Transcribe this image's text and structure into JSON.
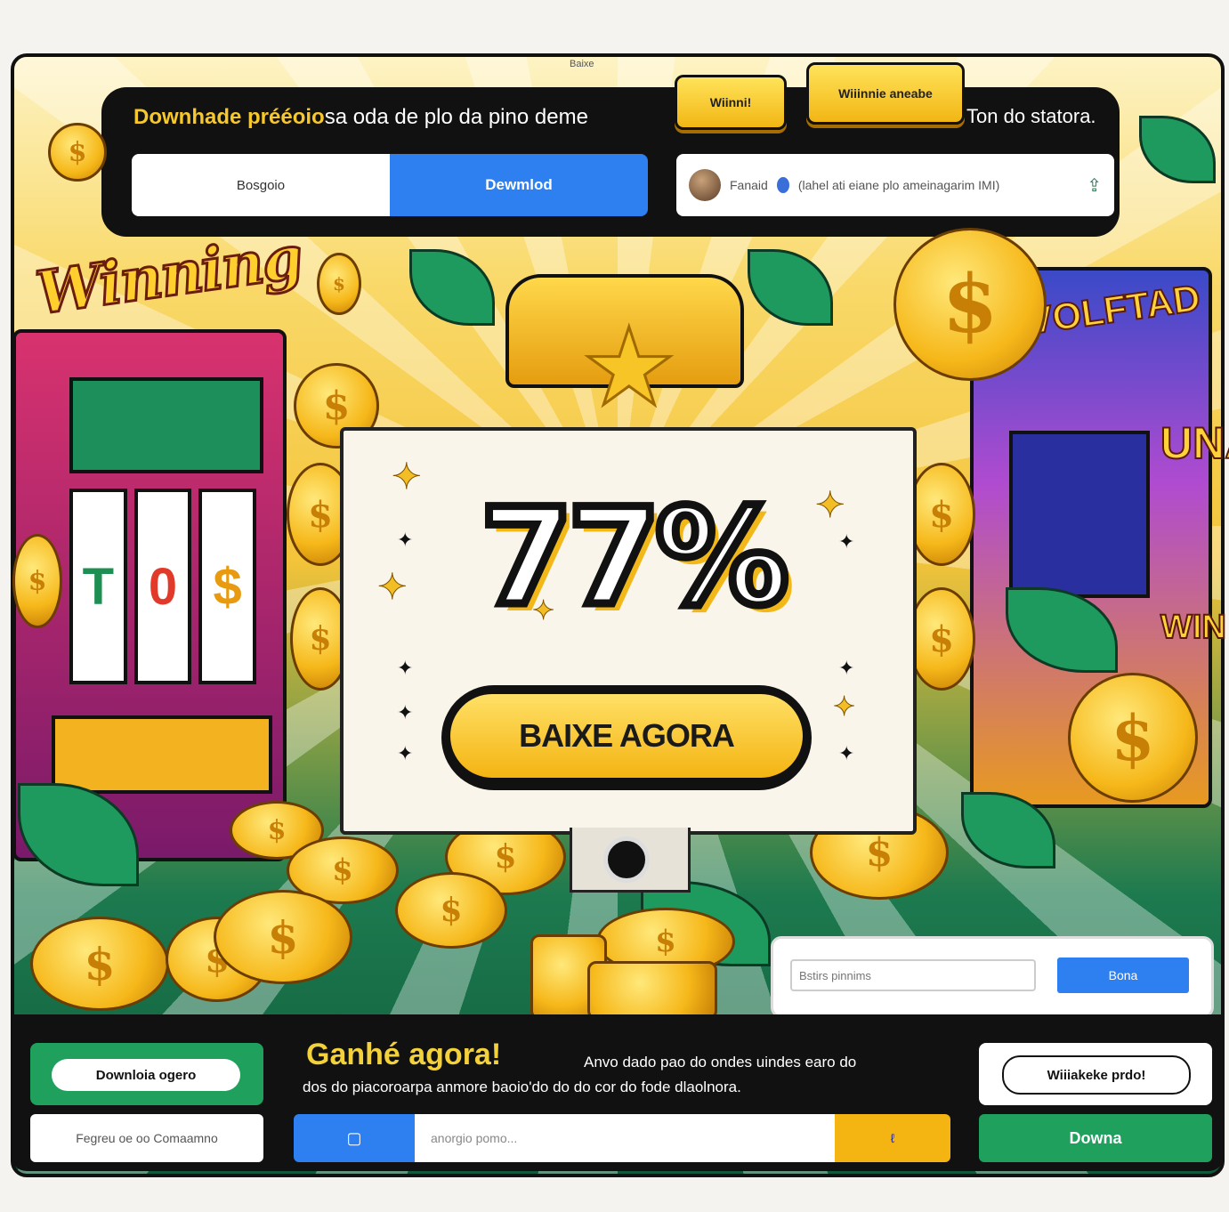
{
  "titlebar": {
    "text": "Baixe"
  },
  "header": {
    "headline_highlight": "Downhade prééoio",
    "headline_rest": "sa oda de plo da pino deme",
    "tagline": "Ton do statora.",
    "btn_winning": "Wiinni!",
    "btn_winning2": "Wiiinnie aneabe"
  },
  "segment": {
    "left": "Bosgoio",
    "right": "Dewmlod"
  },
  "share": {
    "name": "Fanaid",
    "text": "(lahel ati eiane plo ameinagarim IMI)"
  },
  "banner": {
    "sign_left": "Winning",
    "sign_right": "VOLFTAD",
    "slot_right_una": "UNA",
    "slot_right_win": "WIN",
    "percent": "77%",
    "cta": "BAIXE AGORA"
  },
  "search": {
    "placeholder": "Bstirs pinnims",
    "button": "Bona"
  },
  "footer": {
    "download_btn": "Downloia ogero",
    "field_label": "Fegreu oe oo Comaamno",
    "ganhe": "Ganhé agora!",
    "desc_line1": "Anvo dado pao do ondes uindes earo do",
    "desc_line2": "dos do piacoroarpa anmore baoio'do do do cor do fode dlaolnora.",
    "input_icon": "▢",
    "input_placeholder": "anorgio pomo...",
    "input_right": "ℓ",
    "withdraw_btn": "Wiiiakeke prdo!",
    "download_btn2": "Downa"
  },
  "colors": {
    "accent_blue": "#2e7ff0",
    "accent_green": "#1fa05c",
    "gold": "#f4b412",
    "dark": "#111111"
  }
}
